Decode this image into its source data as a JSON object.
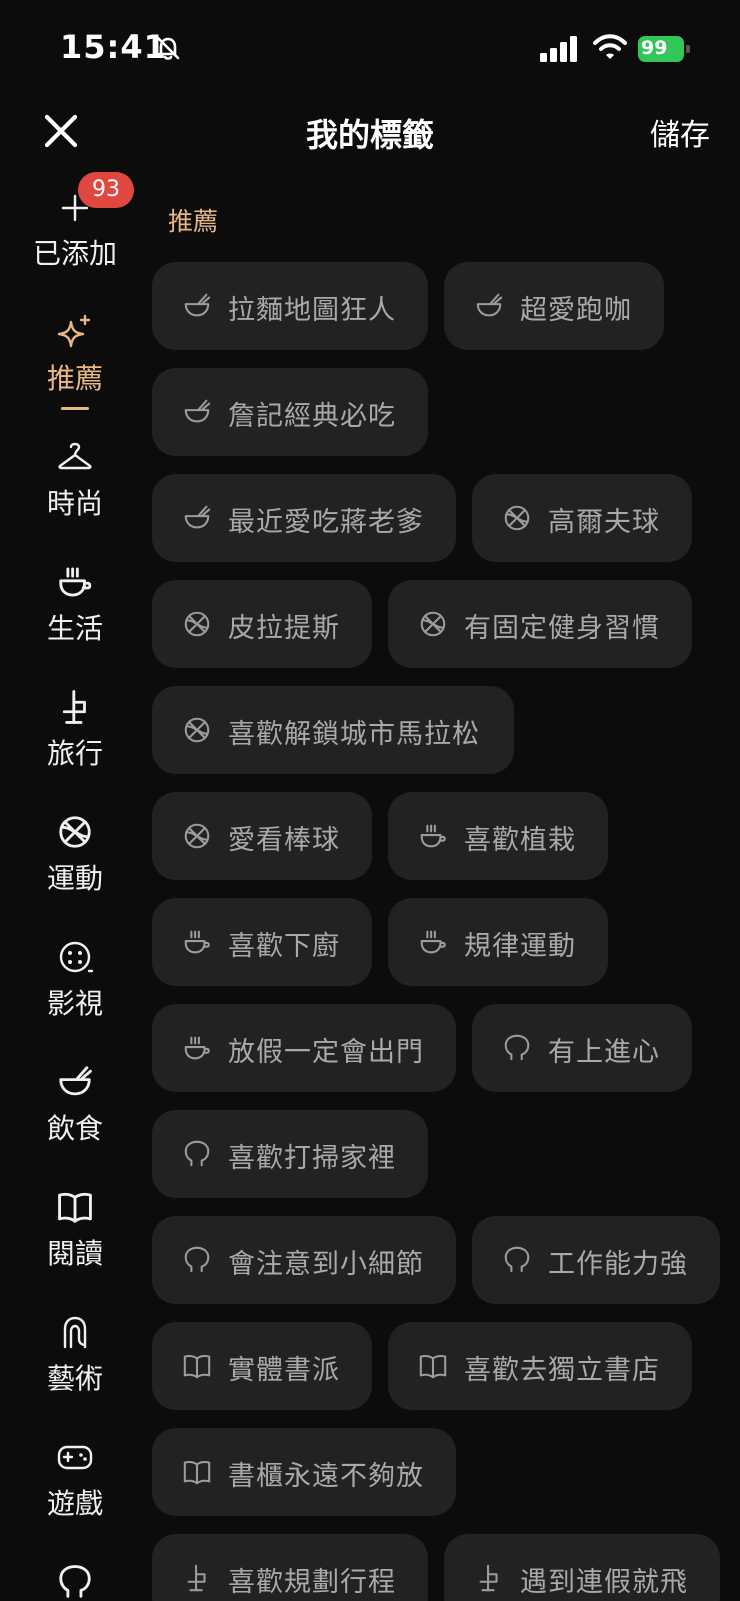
{
  "status_bar": {
    "time": "15:41",
    "silent_icon": "bell-slash-icon",
    "battery": "99",
    "battery_color": "#33c759"
  },
  "header": {
    "title": "我的標籤",
    "close_icon": "close-icon",
    "save_label": "儲存"
  },
  "sidebar": {
    "accent_color": "#e8b784",
    "badge_color": "#e0473f",
    "items": [
      {
        "label": "已添加",
        "icon": "plus-icon",
        "badge": "93"
      },
      {
        "label": "推薦",
        "icon": "sparkle-icon",
        "active": true
      },
      {
        "label": "時尚",
        "icon": "hanger-icon"
      },
      {
        "label": "生活",
        "icon": "cup-icon"
      },
      {
        "label": "旅行",
        "icon": "travel-icon"
      },
      {
        "label": "運動",
        "icon": "ball-icon"
      },
      {
        "label": "影視",
        "icon": "film-icon"
      },
      {
        "label": "飲食",
        "icon": "bowl-icon"
      },
      {
        "label": "閱讀",
        "icon": "book-icon"
      },
      {
        "label": "藝術",
        "icon": "art-icon"
      },
      {
        "label": "遊戲",
        "icon": "gamepad-icon"
      }
    ]
  },
  "content": {
    "section_title": "推薦",
    "chips": [
      {
        "label": "拉麵地圖狂人",
        "icon": "bowl-icon"
      },
      {
        "label": "超愛跑咖",
        "icon": "bowl-icon"
      },
      {
        "label": "詹記經典必吃",
        "icon": "bowl-icon"
      },
      {
        "label": "最近愛吃蔣老爹",
        "icon": "bowl-icon"
      },
      {
        "label": "高爾夫球",
        "icon": "ball-icon"
      },
      {
        "label": "皮拉提斯",
        "icon": "ball-icon"
      },
      {
        "label": "有固定健身習慣",
        "icon": "ball-icon"
      },
      {
        "label": "喜歡解鎖城市馬拉松",
        "icon": "ball-icon"
      },
      {
        "label": "愛看棒球",
        "icon": "ball-icon"
      },
      {
        "label": "喜歡植栽",
        "icon": "cup-icon"
      },
      {
        "label": "喜歡下廚",
        "icon": "cup-icon"
      },
      {
        "label": "規律運動",
        "icon": "cup-icon"
      },
      {
        "label": "放假一定會出門",
        "icon": "cup-icon"
      },
      {
        "label": "有上進心",
        "icon": "head-icon"
      },
      {
        "label": "喜歡打掃家裡",
        "icon": "head-icon"
      },
      {
        "label": "會注意到小細節",
        "icon": "head-icon"
      },
      {
        "label": "工作能力強",
        "icon": "head-icon"
      },
      {
        "label": "實體書派",
        "icon": "book-icon"
      },
      {
        "label": "喜歡去獨立書店",
        "icon": "book-icon"
      },
      {
        "label": "書櫃永遠不夠放",
        "icon": "book-icon"
      },
      {
        "label": "喜歡規劃行程",
        "icon": "travel-icon"
      },
      {
        "label": "遇到連假就飛",
        "icon": "travel-icon"
      }
    ]
  }
}
